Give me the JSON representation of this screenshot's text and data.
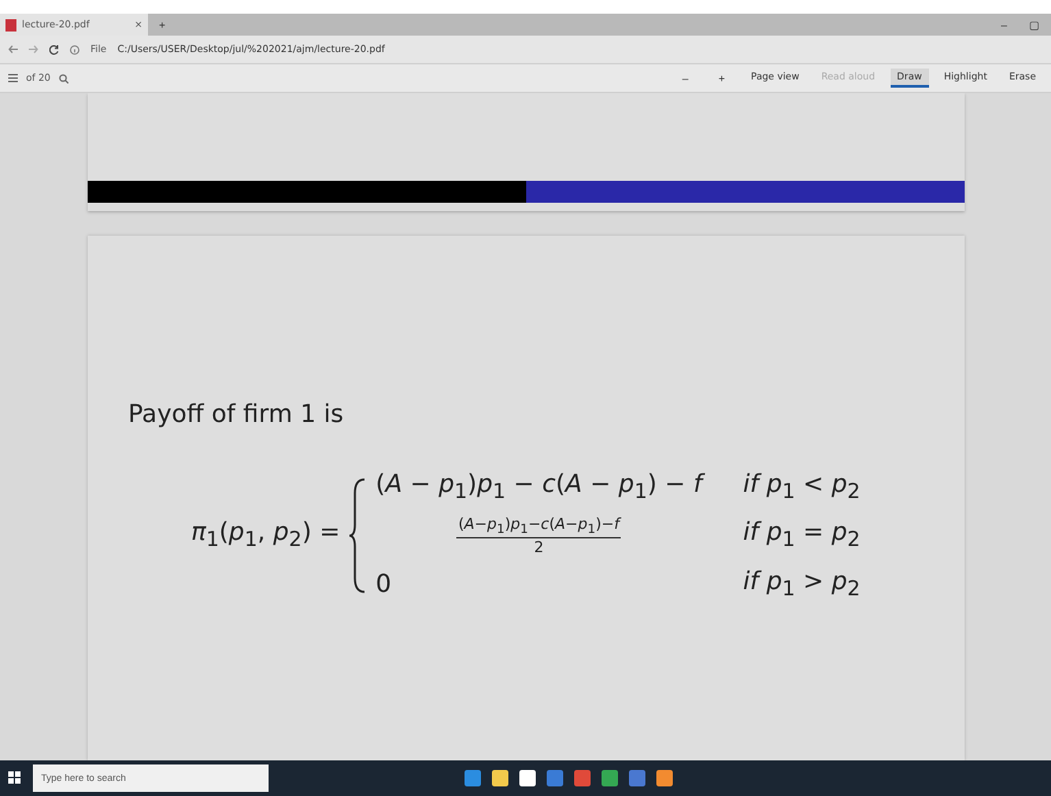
{
  "browser": {
    "tab": {
      "title": "lecture-20.pdf",
      "close": "×",
      "new_tab": "+"
    },
    "window_controls": [
      "–",
      "▢"
    ],
    "address": {
      "scheme": "File",
      "url": "C:/Users/USER/Desktop/jul/%202021/ajm/lecture-20.pdf"
    }
  },
  "pdf_toolbar": {
    "page": "of 20",
    "zoom_out": "–",
    "zoom_in": "+",
    "tools": [
      {
        "label": "Page view",
        "selected": false,
        "disabled": false
      },
      {
        "label": "Read aloud",
        "selected": false,
        "disabled": true
      },
      {
        "label": "Draw",
        "selected": true,
        "disabled": false
      },
      {
        "label": "Highlight",
        "selected": false,
        "disabled": false
      },
      {
        "label": "Erase",
        "selected": false,
        "disabled": false
      }
    ]
  },
  "slide": {
    "heading": "Payoff of firm 1 is",
    "lhs": "*π*$_{1}$(*p*$_{1}$, *p*$_{2}$) =",
    "cases": [
      {
        "kind": "plain",
        "expression": "(*A* − *p*$_{1}$)*p*$_{1}$ − *c*(*A* − *p*$_{1}$) − *f*",
        "condition": "*if p*$_{1}$ < *p*$_{2}$"
      },
      {
        "kind": "fraction",
        "numerator": "(*A*−*p*$_{1}$)*p*$_{1}$−*c*(*A*−*p*$_{1}$)−*f*",
        "denominator": "2",
        "condition": "*if p*$_{1}$ = *p*$_{2}$"
      },
      {
        "kind": "plain",
        "expression": "0",
        "condition": "*if p*$_{1}$ > *p*$_{2}$"
      }
    ]
  },
  "taskbar": {
    "search": {
      "placeholder": "Type here to search"
    }
  }
}
